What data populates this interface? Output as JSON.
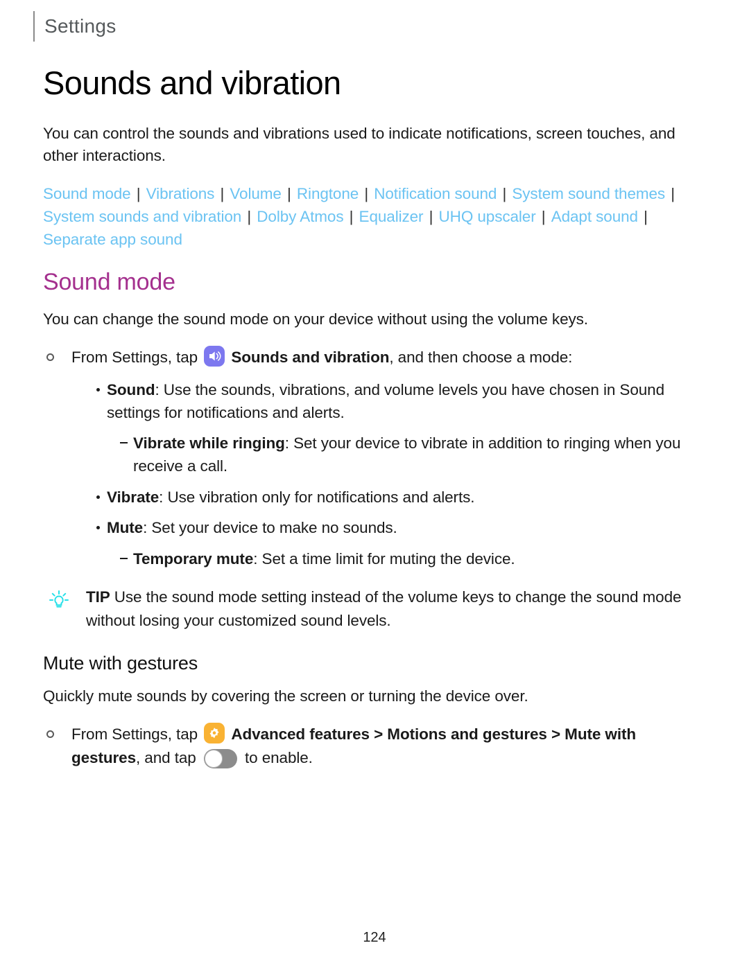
{
  "header": {
    "title": "Settings"
  },
  "doc": {
    "title": "Sounds and vibration",
    "intro": "You can control the sounds and vibrations used to indicate notifications, screen touches, and other interactions."
  },
  "links": [
    "Sound mode",
    "Vibrations",
    "Volume",
    "Ringtone",
    "Notification sound",
    "System sound themes",
    "System sounds and vibration",
    "Dolby Atmos",
    "Equalizer",
    "UHQ upscaler",
    "Adapt sound",
    "Separate app sound"
  ],
  "link_separator": "|",
  "sound_mode": {
    "heading": "Sound mode",
    "intro": "You can change the sound mode on your device without using the volume keys.",
    "step": {
      "prefix": "From Settings, tap",
      "icon": "sound-icon",
      "bold_target": "Sounds and vibration",
      "suffix": ", and then choose a mode:"
    },
    "items": [
      {
        "level": 1,
        "term": "Sound",
        "desc": ": Use the sounds, vibrations, and volume levels you have chosen in Sound settings for notifications and alerts."
      },
      {
        "level": 2,
        "term": "Vibrate while ringing",
        "desc": ": Set your device to vibrate in addition to ringing when you receive a call."
      },
      {
        "level": 1,
        "term": "Vibrate",
        "desc": ": Use vibration only for notifications and alerts."
      },
      {
        "level": 1,
        "term": "Mute",
        "desc": ": Set your device to make no sounds."
      },
      {
        "level": 2,
        "term": "Temporary mute",
        "desc": ": Set a time limit for muting the device."
      }
    ],
    "tip": {
      "icon": "lightbulb-icon",
      "label": "TIP",
      "text": "Use the sound mode setting instead of the volume keys to change the sound mode without losing your customized sound levels."
    }
  },
  "mute_with_gestures": {
    "heading": "Mute with gestures",
    "intro": "Quickly mute sounds by covering the screen or turning the device over.",
    "step": {
      "prefix": "From Settings, tap",
      "icon": "gear-icon",
      "bold_path": "Advanced features > Motions and gestures > Mute with gestures",
      "middle": ", and tap",
      "toggle": "toggle-off",
      "suffix": "to enable."
    }
  },
  "footer": {
    "page_number": "124"
  },
  "colors": {
    "link": "#6bc3f2",
    "section_heading": "#a4308e",
    "sound_icon_bg": "#7d78ef",
    "gear_icon_bg": "#f9b233",
    "tip_icon": "#26e0e8",
    "toggle_off": "#8c8c8c"
  }
}
